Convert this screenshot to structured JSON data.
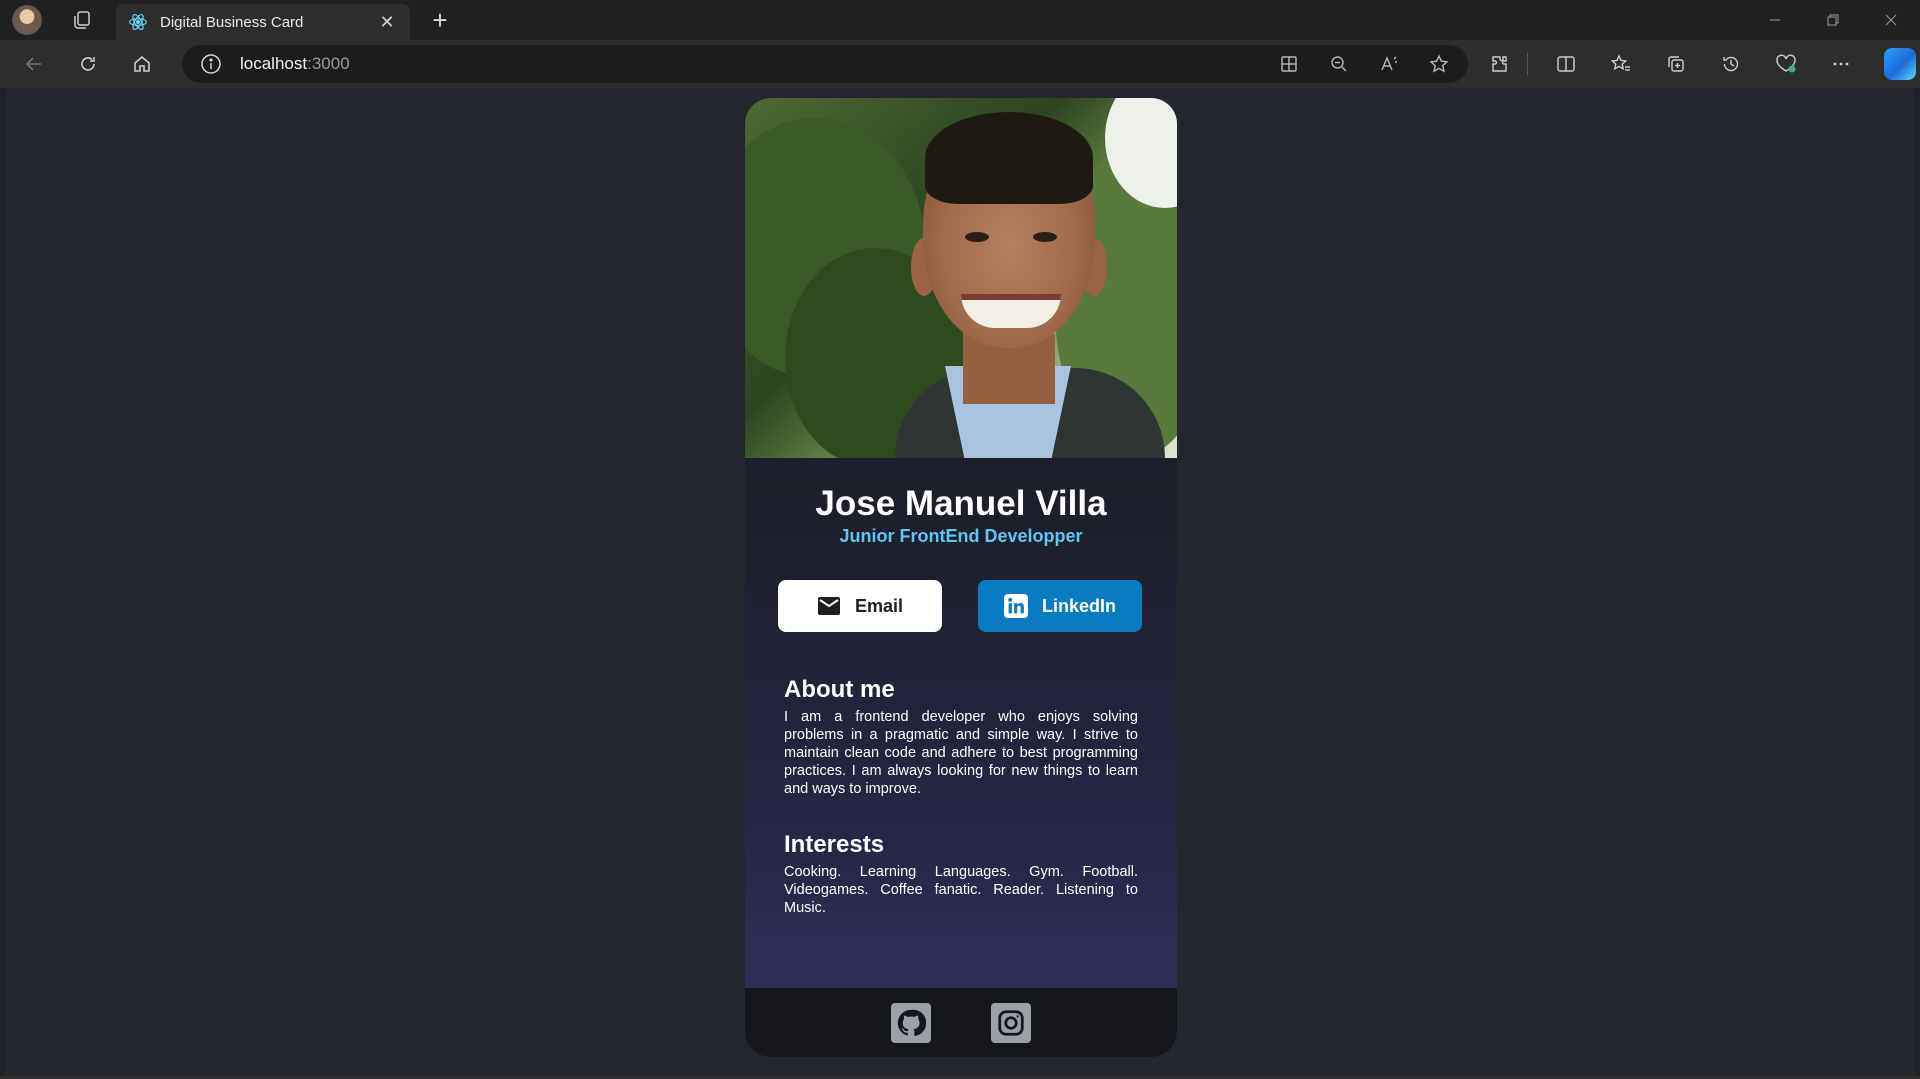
{
  "browser": {
    "tab_title": "Digital Business Card",
    "address_host": "localhost",
    "address_port": ":3000"
  },
  "card": {
    "name": "Jose Manuel Villa",
    "role": "Junior FrontEnd Developper",
    "buttons": {
      "email_label": "Email",
      "linkedin_label": "LinkedIn"
    },
    "about": {
      "title": "About me",
      "text": "I am a frontend developer who enjoys solving problems in a pragmatic and simple way. I strive to maintain clean code and adhere to best programming practices. I am always looking for new things to learn and ways to improve."
    },
    "interests": {
      "title": "Interests",
      "text": "Cooking. Learning Languages. Gym. Football. Videogames. Coffee fanatic. Reader. Listening to Music."
    },
    "footer_icons": [
      "github-icon",
      "instagram-icon"
    ]
  },
  "colors": {
    "accent": "#5ec8f2",
    "linkedin": "#0a7bc2",
    "page_bg": "#23262e"
  }
}
